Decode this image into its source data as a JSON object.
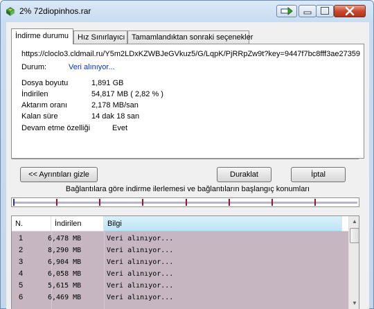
{
  "window": {
    "title": "2% 72diopinhos.rar"
  },
  "tabs": [
    {
      "label": "İndirme durumu"
    },
    {
      "label": "Hız Sınırlayıcı"
    },
    {
      "label": "Tamamlandıktan sonraki seçenekler"
    }
  ],
  "status": {
    "url": "https://cloclo3.cldmail.ru/Y5m2LDxKZWBJeGVkuz5/G/LqpK/PjRRpZw9t?key=9447f7bc8fff3ae27359",
    "status_label": "Durum:",
    "status_value": "Veri alınıyor...",
    "fields": [
      {
        "label": "Dosya boyutu",
        "value": "1,891  GB"
      },
      {
        "label": "İndirilen",
        "value": "54,817  MB  ( 2,82 % )"
      },
      {
        "label": "Aktarım oranı",
        "value": "2,178  MB/san"
      },
      {
        "label": "Kalan süre",
        "value": "14 dak 18 san"
      },
      {
        "label": "Devam etme özelliği",
        "value": "Evet"
      }
    ]
  },
  "progress": {
    "fraction": 0.0282,
    "fill_color": "#27b127"
  },
  "buttons": {
    "details": "<< Ayrıntıları gizle",
    "pause": "Duraklat",
    "cancel": "İptal"
  },
  "connections": {
    "caption": "Bağlantılara göre indirme ilerlemesi ve bağlantıların başlangıç konumları",
    "marker_color": "#a0142a",
    "start_color": "#2030c0"
  },
  "table": {
    "columns": [
      "N.",
      "İndirilen",
      "Bilgi"
    ],
    "rows": [
      {
        "n": "1",
        "downloaded": "6,478  MB",
        "info": "Veri alınıyor..."
      },
      {
        "n": "2",
        "downloaded": "8,290  MB",
        "info": "Veri alınıyor..."
      },
      {
        "n": "3",
        "downloaded": "6,904  MB",
        "info": "Veri alınıyor..."
      },
      {
        "n": "4",
        "downloaded": "6,058  MB",
        "info": "Veri alınıyor..."
      },
      {
        "n": "5",
        "downloaded": "5,615  MB",
        "info": "Veri alınıyor..."
      },
      {
        "n": "6",
        "downloaded": "6,469  MB",
        "info": "Veri alınıyor..."
      }
    ],
    "row_color": "#c5b6c2"
  },
  "icons": {
    "app": "idm-download-icon",
    "arrow": "arrow-right-icon",
    "minimize": "minimize-icon",
    "maximize": "maximize-icon",
    "close": "close-icon"
  }
}
